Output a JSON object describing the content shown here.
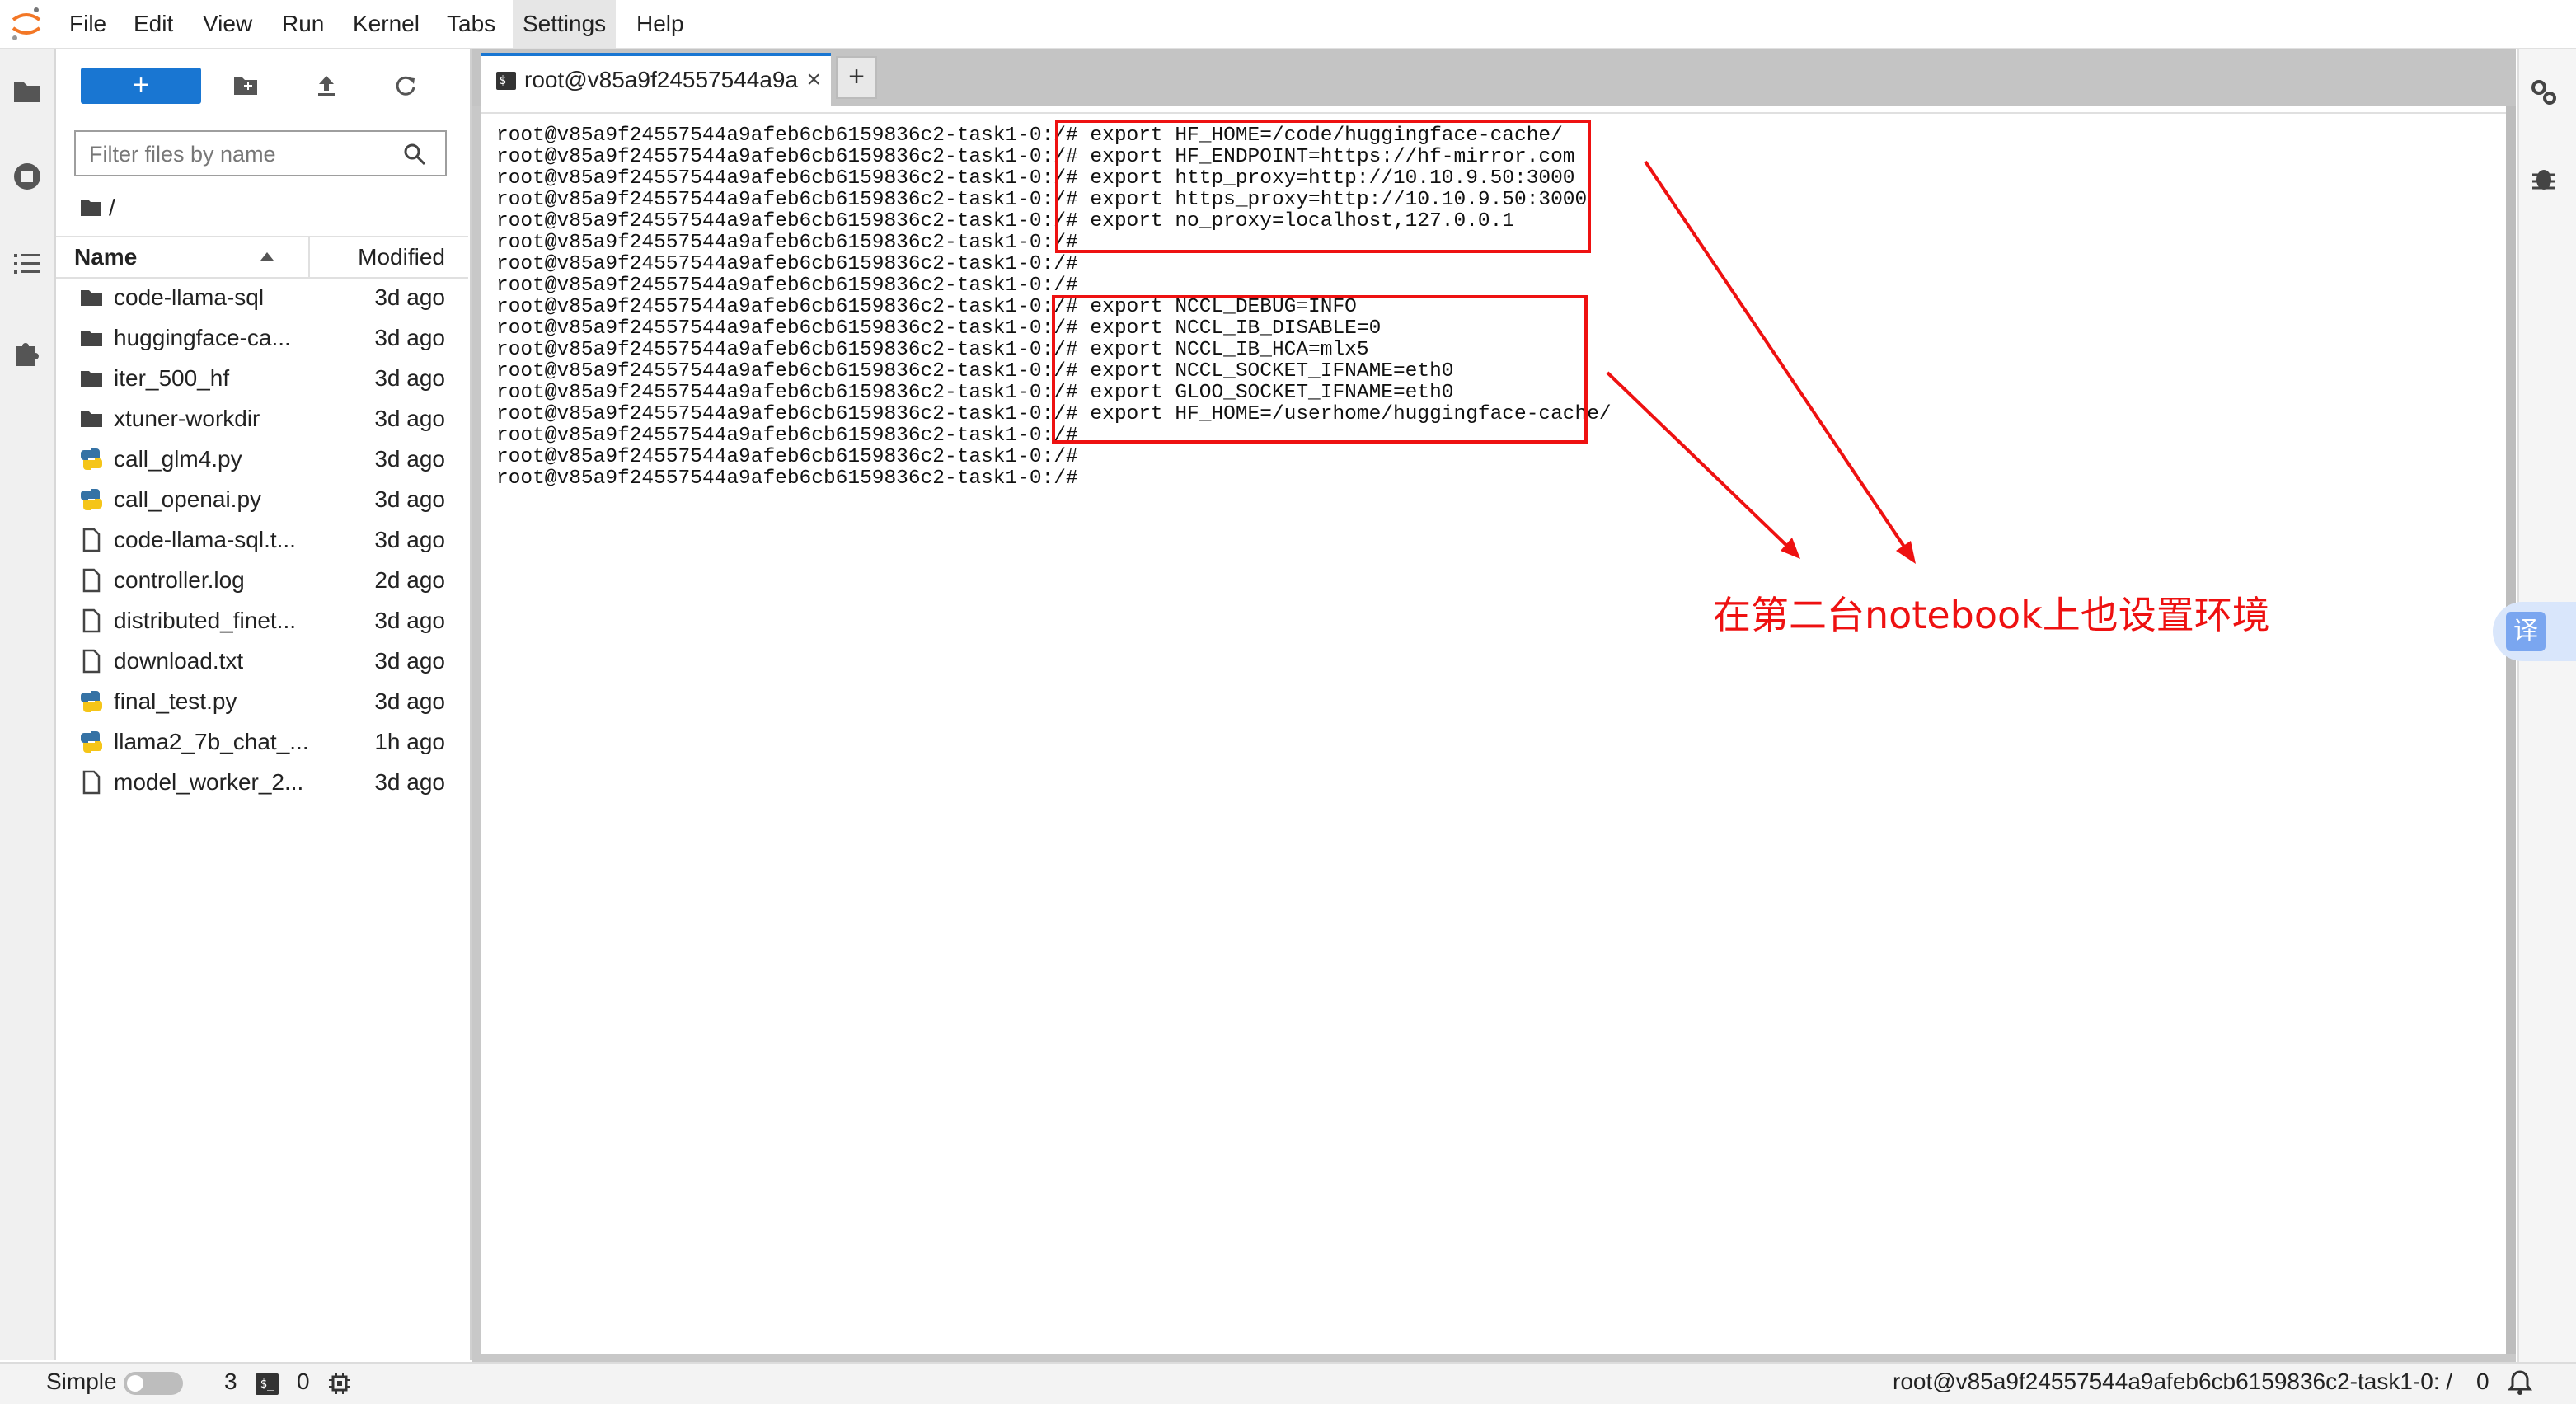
{
  "menu": {
    "logo_icon": "jupyter-logo-icon",
    "items": [
      "File",
      "Edit",
      "View",
      "Run",
      "Kernel",
      "Tabs",
      "Settings",
      "Help"
    ],
    "active_item": "Settings"
  },
  "left_sidebar": {
    "icons": [
      "folder-icon",
      "running-stop-icon",
      "table-of-contents-icon",
      "extension-puzzle-icon"
    ]
  },
  "file_browser": {
    "new_button_label": "+",
    "toolbar_icons": [
      "new-folder-icon",
      "upload-icon",
      "refresh-icon"
    ],
    "filter_placeholder": "Filter files by name",
    "breadcrumb": "/",
    "columns": {
      "name": "Name",
      "modified": "Modified"
    },
    "files": [
      {
        "name": "code-llama-sql",
        "modified": "3d ago",
        "type": "folder"
      },
      {
        "name": "huggingface-ca...",
        "modified": "3d ago",
        "type": "folder"
      },
      {
        "name": "iter_500_hf",
        "modified": "3d ago",
        "type": "folder"
      },
      {
        "name": "xtuner-workdir",
        "modified": "3d ago",
        "type": "folder"
      },
      {
        "name": "call_glm4.py",
        "modified": "3d ago",
        "type": "python"
      },
      {
        "name": "call_openai.py",
        "modified": "3d ago",
        "type": "python"
      },
      {
        "name": "code-llama-sql.t...",
        "modified": "3d ago",
        "type": "file"
      },
      {
        "name": "controller.log",
        "modified": "2d ago",
        "type": "file"
      },
      {
        "name": "distributed_finet...",
        "modified": "3d ago",
        "type": "file"
      },
      {
        "name": "download.txt",
        "modified": "3d ago",
        "type": "file"
      },
      {
        "name": "final_test.py",
        "modified": "3d ago",
        "type": "python"
      },
      {
        "name": "llama2_7b_chat_...",
        "modified": "1h ago",
        "type": "python"
      },
      {
        "name": "model_worker_2...",
        "modified": "3d ago",
        "type": "file"
      }
    ]
  },
  "tabs": {
    "terminal_tab_label": "root@v85a9f24557544a9a",
    "terminal_icon_glyph": "$_",
    "close_glyph": "×",
    "add_tab_label": "+"
  },
  "terminal": {
    "lines": [
      "root@v85a9f24557544a9afeb6cb6159836c2-task1-0:/# export HF_HOME=/code/huggingface-cache/",
      "root@v85a9f24557544a9afeb6cb6159836c2-task1-0:/# export HF_ENDPOINT=https://hf-mirror.com",
      "root@v85a9f24557544a9afeb6cb6159836c2-task1-0:/# export http_proxy=http://10.10.9.50:3000",
      "root@v85a9f24557544a9afeb6cb6159836c2-task1-0:/# export https_proxy=http://10.10.9.50:3000",
      "root@v85a9f24557544a9afeb6cb6159836c2-task1-0:/# export no_proxy=localhost,127.0.0.1",
      "root@v85a9f24557544a9afeb6cb6159836c2-task1-0:/#",
      "root@v85a9f24557544a9afeb6cb6159836c2-task1-0:/#",
      "root@v85a9f24557544a9afeb6cb6159836c2-task1-0:/#",
      "root@v85a9f24557544a9afeb6cb6159836c2-task1-0:/# export NCCL_DEBUG=INFO",
      "root@v85a9f24557544a9afeb6cb6159836c2-task1-0:/# export NCCL_IB_DISABLE=0",
      "root@v85a9f24557544a9afeb6cb6159836c2-task1-0:/# export NCCL_IB_HCA=mlx5",
      "root@v85a9f24557544a9afeb6cb6159836c2-task1-0:/# export NCCL_SOCKET_IFNAME=eth0",
      "root@v85a9f24557544a9afeb6cb6159836c2-task1-0:/# export GLOO_SOCKET_IFNAME=eth0",
      "root@v85a9f24557544a9afeb6cb6159836c2-task1-0:/# export HF_HOME=/userhome/huggingface-cache/",
      "root@v85a9f24557544a9afeb6cb6159836c2-task1-0:/#",
      "root@v85a9f24557544a9afeb6cb6159836c2-task1-0:/#",
      "root@v85a9f24557544a9afeb6cb6159836c2-task1-0:/#"
    ]
  },
  "annotation": {
    "text": "在第二台notebook上也设置环境",
    "color": "#ee1111"
  },
  "right_sidebar": {
    "icons": [
      "property-inspector-gear-icon",
      "debugger-bug-icon"
    ],
    "translate_label": "译"
  },
  "status_bar": {
    "mode_label": "Simple",
    "kernel_count": "3",
    "terminal_count": "0",
    "terminal_icon_glyph": "$_",
    "kernel_icon": "cpu-chip-icon",
    "current_item": "root@v85a9f24557544a9afeb6cb6159836c2-task1-0: /",
    "notification_count": "0",
    "bell_icon": "bell-icon"
  },
  "colors": {
    "accent": "#1976d2",
    "dock_background": "#c8c8c8",
    "annotation_red": "#ee1111"
  }
}
